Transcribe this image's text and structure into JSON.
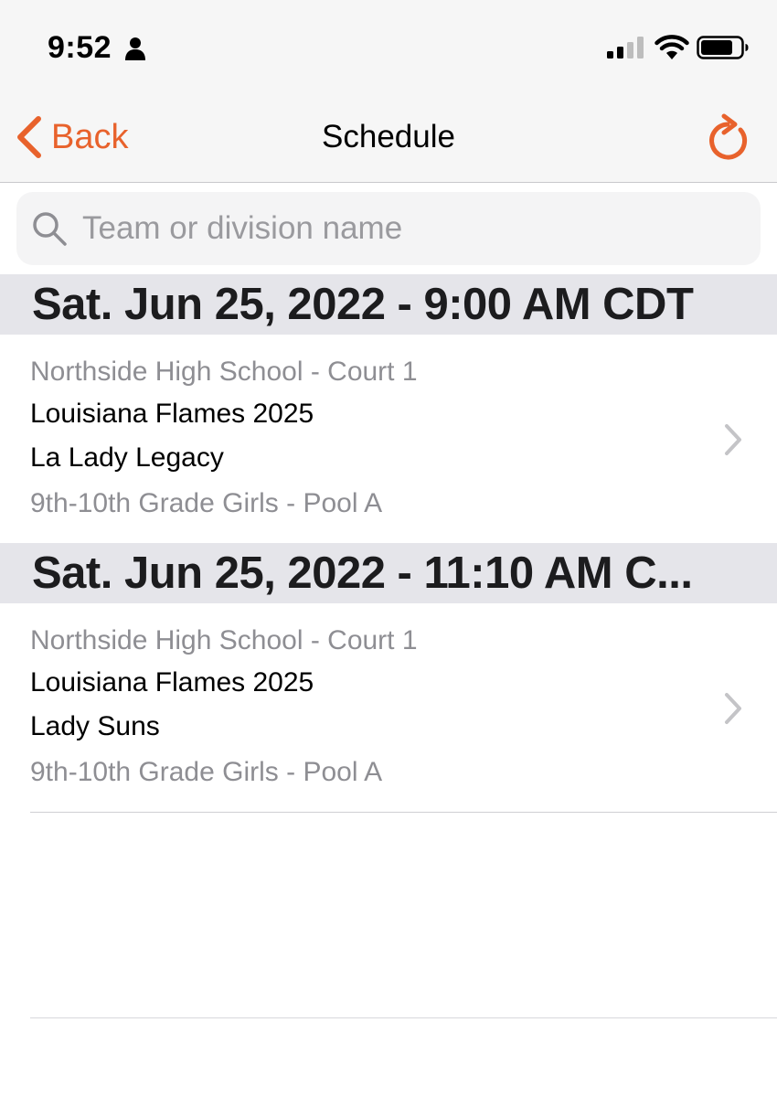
{
  "status_bar": {
    "time": "9:52"
  },
  "nav": {
    "back_label": "Back",
    "title": "Schedule"
  },
  "search": {
    "placeholder": "Team or division name",
    "value": ""
  },
  "sections": [
    {
      "header": "Sat. Jun 25, 2022 - 9:00 AM CDT",
      "game": {
        "venue": "Northside High School - Court 1",
        "team1": "Louisiana Flames 2025",
        "team2": "La Lady Legacy",
        "division": "9th-10th Grade Girls - Pool A"
      }
    },
    {
      "header": "Sat. Jun 25, 2022 - 11:10 AM C...",
      "game": {
        "venue": "Northside High School - Court 1",
        "team1": "Louisiana Flames 2025",
        "team2": "Lady Suns",
        "division": "9th-10th Grade Girls - Pool A"
      }
    }
  ],
  "icons": {
    "back": "chevron-left-icon",
    "refresh": "refresh-icon",
    "search": "search-icon",
    "row_disclosure": "chevron-right-icon",
    "status": [
      "person-icon",
      "cellular-signal-icon",
      "wifi-icon",
      "battery-icon"
    ]
  },
  "colors": {
    "accent": "#e8622c",
    "section_header_bg": "#e5e5ea",
    "secondary_text": "#8e8e93",
    "nav_bg": "#f6f6f6"
  }
}
